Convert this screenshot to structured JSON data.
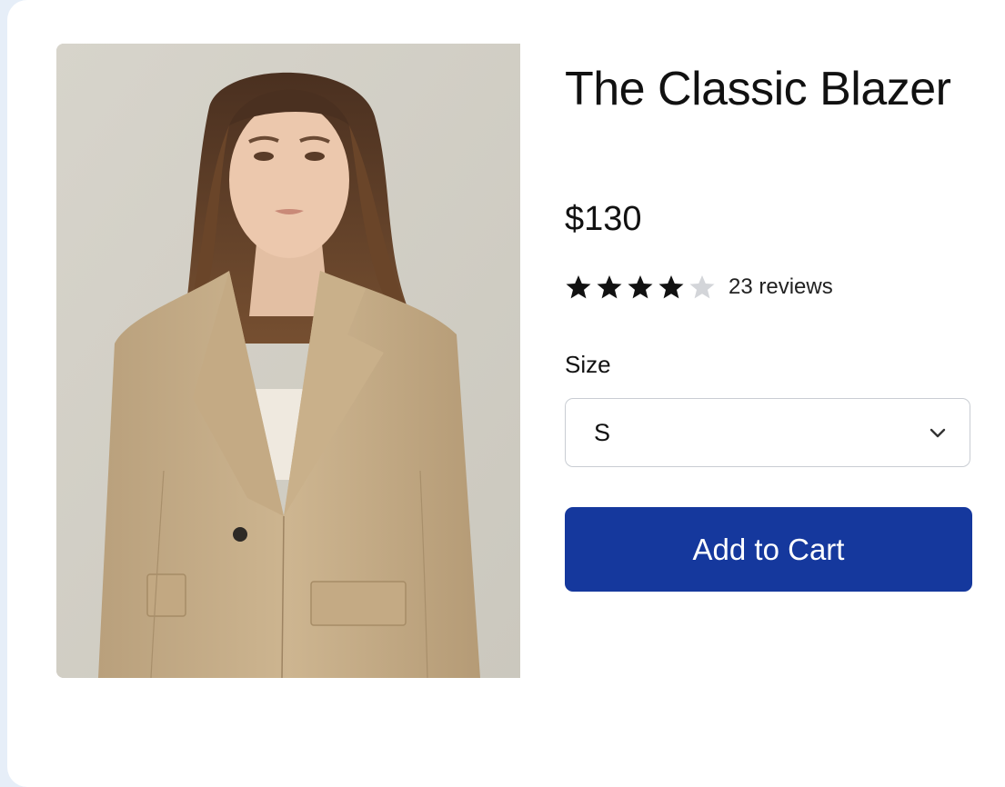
{
  "product": {
    "title": "The Classic Blazer",
    "price": "$130",
    "image_alt": "Model wearing a camel single-button blazer over a cream top"
  },
  "rating": {
    "stars_filled": 4,
    "stars_total": 5,
    "reviews_label": "23 reviews",
    "filled_color": "#111111",
    "empty_color": "#d3d5d9"
  },
  "size": {
    "label": "Size",
    "selected": "S",
    "icon": "chevron-down-icon"
  },
  "cart": {
    "button_label": "Add to Cart",
    "button_color": "#15389d"
  }
}
